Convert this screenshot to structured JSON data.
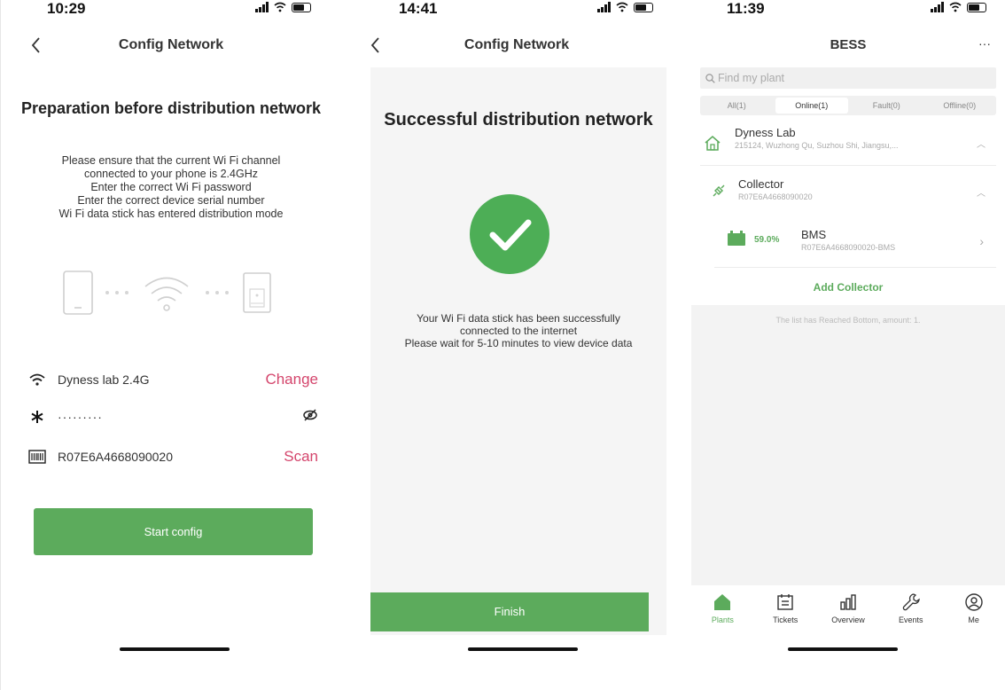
{
  "screen1": {
    "time": "10:29",
    "title": "Config Network",
    "heading": "Preparation before distribution network",
    "instructions": [
      "Please ensure that the current Wi Fi channel",
      "connected to your phone is 2.4GHz",
      "Enter the correct Wi Fi password",
      "Enter the correct device serial number",
      "Wi Fi data stick has entered distribution mode"
    ],
    "wifi_name": "Dyness lab 2.4G",
    "change_label": "Change",
    "password_mask": "·········",
    "serial": "R07E6A4668090020",
    "scan_label": "Scan",
    "start_button": "Start config"
  },
  "screen2": {
    "time": "14:41",
    "title": "Config Network",
    "heading": "Successful distribution network",
    "messages": [
      "Your Wi Fi data stick has been successfully",
      "connected to the internet",
      "Please wait for 5-10 minutes to view device data"
    ],
    "finish_button": "Finish"
  },
  "screen3": {
    "time": "11:39",
    "title": "BESS",
    "more": "···",
    "search_placeholder": "Find my plant",
    "tabs": [
      "All(1)",
      "Online(1)",
      "Fault(0)",
      "Offline(0)"
    ],
    "plant_name": "Dyness Lab",
    "plant_address": "215124, Wuzhong Qu, Suzhou Shi, Jiangsu,...",
    "collector_label": "Collector",
    "collector_sn": "R07E6A4668090020",
    "bms_soc": "59.0%",
    "bms_label": "BMS",
    "bms_sn": "R07E6A4668090020-BMS",
    "add_collector": "Add Collector",
    "list_end": "The list has Reached Bottom, amount: 1.",
    "nav": [
      "Plants",
      "Tickets",
      "Overview",
      "Events",
      "Me"
    ]
  },
  "colors": {
    "accent_green": "#5cab5c",
    "action_pink": "#d4456c",
    "success_green": "#4dae56"
  }
}
